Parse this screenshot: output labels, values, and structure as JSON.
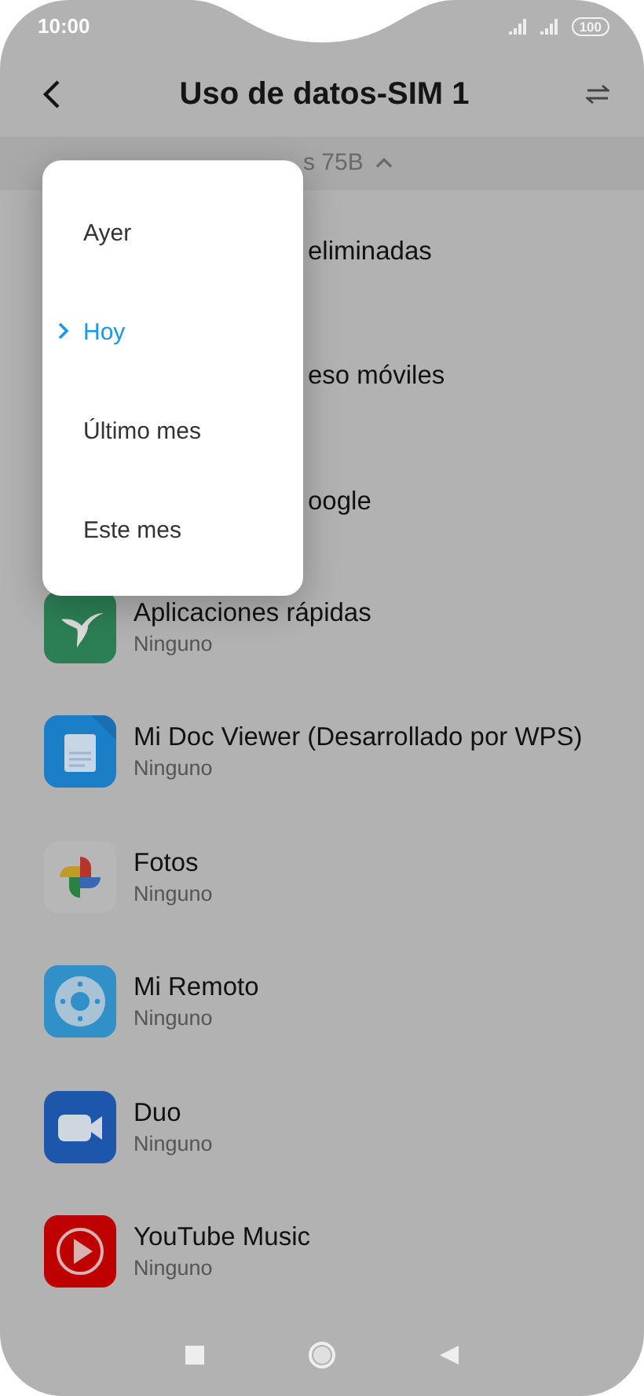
{
  "status_bar": {
    "time": "10:00",
    "battery": "100"
  },
  "header": {
    "title": "Uso de datos-SIM 1"
  },
  "summary": {
    "text": "s 75B"
  },
  "apps": [
    {
      "kind": "covered",
      "name": "eliminadas"
    },
    {
      "kind": "covered",
      "name": "eso móviles"
    },
    {
      "kind": "covered",
      "name": "oogle"
    },
    {
      "kind": "app",
      "name": "Aplicaciones rápidas",
      "usage": "Ninguno"
    },
    {
      "kind": "app",
      "name": "Mi Doc Viewer (Desarrollado por WPS)",
      "usage": "Ninguno"
    },
    {
      "kind": "app",
      "name": "Fotos",
      "usage": "Ninguno"
    },
    {
      "kind": "app",
      "name": "Mi Remoto",
      "usage": "Ninguno"
    },
    {
      "kind": "app",
      "name": "Duo",
      "usage": "Ninguno"
    },
    {
      "kind": "app",
      "name": "YouTube Music",
      "usage": "Ninguno"
    }
  ],
  "menu": {
    "items": [
      {
        "label": "Ayer",
        "selected": false
      },
      {
        "label": "Hoy",
        "selected": true
      },
      {
        "label": "Último mes",
        "selected": false
      },
      {
        "label": "Este mes",
        "selected": false
      }
    ]
  }
}
